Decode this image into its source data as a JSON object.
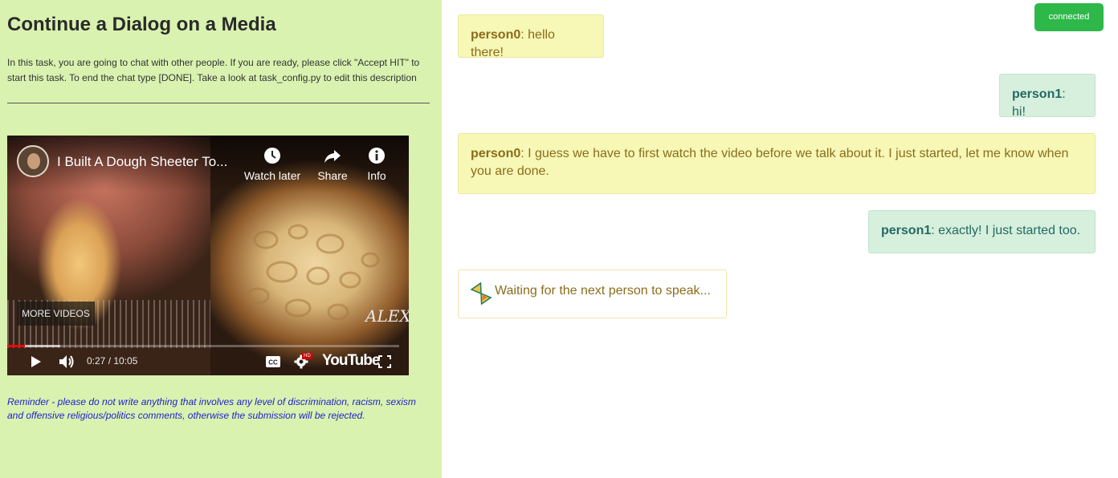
{
  "task": {
    "title": "Continue a Dialog on a Media",
    "description": "In this task, you are going to chat with other people. If you are ready, please click \"Accept HIT\" to start this task. To end the chat type [DONE]. Take a look at task_config.py to edit this description",
    "reminder": "Reminder - please do not write anything that involves any level of discrimination, racism, sexism and offensive religious/politics comments, otherwise the submission will be rejected."
  },
  "video": {
    "title": "I Built A Dough Sheeter To...",
    "actions": [
      {
        "label": "Watch later",
        "icon": "clock-icon"
      },
      {
        "label": "Share",
        "icon": "share-arrow-icon"
      },
      {
        "label": "Info",
        "icon": "info-icon"
      }
    ],
    "more_videos_label": "MORE VIDEOS",
    "time_display": "0:27 / 10:05",
    "progress_fraction": 0.045,
    "buffered_fraction": 0.135,
    "logo_text": "YouTube",
    "hd_badge": "HD",
    "watermark": "ALEX"
  },
  "status": {
    "connection_label": "connected",
    "connection_color": "#2eb84a"
  },
  "messages": [
    {
      "speaker": "person0",
      "text": ": hello there!"
    },
    {
      "speaker": "person1",
      "text": ": hi!"
    },
    {
      "speaker": "person0",
      "text": ": I guess we have to first watch the video before we talk about it. I just started, let me know when you are done."
    },
    {
      "speaker": "person1",
      "text": ": exactly! I just started too."
    }
  ],
  "waiting_text": "Waiting for the next person to speak...",
  "colors": {
    "left_pane_bg": "#d9f2b0",
    "person0_bubble": "#f7f7b6",
    "person1_bubble": "#d7efdd",
    "reminder_text": "#2222cc"
  }
}
